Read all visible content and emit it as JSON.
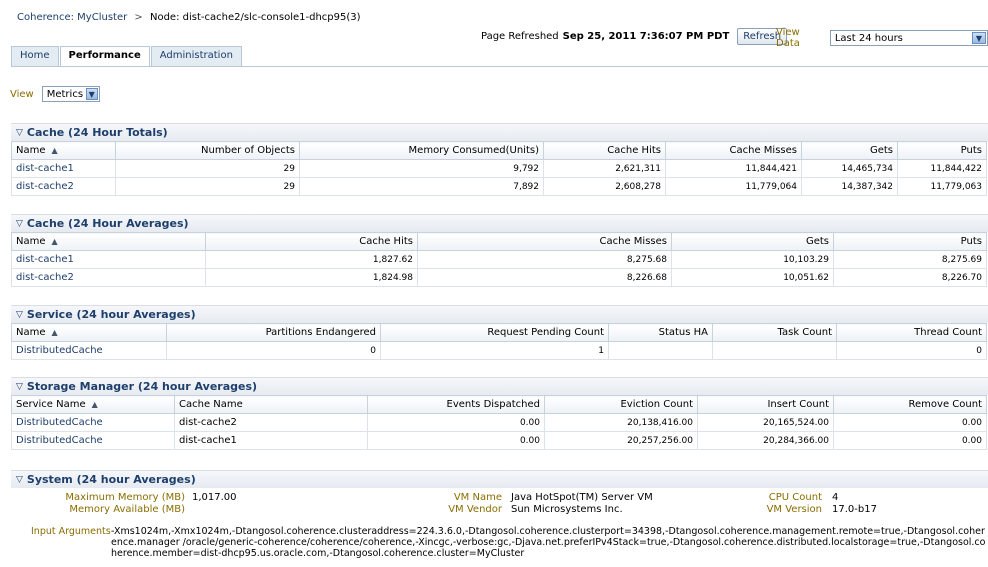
{
  "breadcrumb": {
    "cluster": "Coherence: MyCluster",
    "separator": ">",
    "node": "Node: dist-cache2/slc-console1-dhcp95(3)"
  },
  "header": {
    "refreshed_label": "Page Refreshed",
    "refreshed_value": "Sep 25, 2011 7:36:07 PM PDT",
    "refresh_button": "Refresh",
    "view_data_label": "View Data",
    "view_data_value": "Last 24 hours"
  },
  "tabs": [
    {
      "label": "Home"
    },
    {
      "label": "Performance"
    },
    {
      "label": "Administration"
    }
  ],
  "view": {
    "label": "View",
    "value": "Metrics"
  },
  "cache_totals": {
    "title": "Cache (24 Hour Totals)",
    "columns": [
      "Name",
      "Number of Objects",
      "Memory Consumed(Units)",
      "Cache Hits",
      "Cache Misses",
      "Gets",
      "Puts"
    ],
    "rows": [
      [
        "dist-cache1",
        "29",
        "9,792",
        "2,621,311",
        "11,844,421",
        "14,465,734",
        "11,844,422"
      ],
      [
        "dist-cache2",
        "29",
        "7,892",
        "2,608,278",
        "11,779,064",
        "14,387,342",
        "11,779,063"
      ]
    ]
  },
  "cache_averages": {
    "title": "Cache (24 Hour Averages)",
    "columns": [
      "Name",
      "Cache Hits",
      "Cache Misses",
      "Gets",
      "Puts"
    ],
    "rows": [
      [
        "dist-cache1",
        "1,827.62",
        "8,275.68",
        "10,103.29",
        "8,275.69"
      ],
      [
        "dist-cache2",
        "1,824.98",
        "8,226.68",
        "10,051.62",
        "8,226.70"
      ]
    ]
  },
  "service": {
    "title": "Service (24 hour Averages)",
    "columns": [
      "Name",
      "Partitions Endangered",
      "Request Pending Count",
      "Status HA",
      "Task Count",
      "Thread Count"
    ],
    "rows": [
      [
        "DistributedCache",
        "0",
        "1",
        "",
        "",
        "0"
      ]
    ]
  },
  "storage": {
    "title": "Storage Manager (24 hour Averages)",
    "columns": [
      "Service Name",
      "Cache Name",
      "Events Dispatched",
      "Eviction Count",
      "Insert Count",
      "Remove Count"
    ],
    "rows": [
      [
        "DistributedCache",
        "dist-cache2",
        "0.00",
        "20,138,416.00",
        "20,165,524.00",
        "0.00"
      ],
      [
        "DistributedCache",
        "dist-cache1",
        "0.00",
        "20,257,256.00",
        "20,284,366.00",
        "0.00"
      ]
    ]
  },
  "system": {
    "title": "System (24 hour Averages)",
    "max_memory_label": "Maximum Memory (MB)",
    "max_memory": "1,017.00",
    "mem_avail_label": "Memory Available (MB)",
    "mem_avail": "",
    "vm_name_label": "VM Name",
    "vm_name": "Java HotSpot(TM) Server VM",
    "vm_vendor_label": "VM Vendor",
    "vm_vendor": "Sun Microsystems Inc.",
    "cpu_label": "CPU Count",
    "cpu": "4",
    "vm_version_label": "VM Version",
    "vm_version": "17.0-b17",
    "input_args_label": "Input Arguments",
    "input_args": "-Xms1024m,-Xmx1024m,-Dtangosol.coherence.clusteraddress=224.3.6.0,-Dtangosol.coherence.clusterport=34398,-Dtangosol.coherence.management.remote=true,-Dtangosol.coherence.manager /oracle/generic-coherence/coherence/coherence,-Xincgc,-verbose:gc,-Djava.net.preferIPv4Stack=true,-Dtangosol.coherence.distributed.localstorage=true,-Dtangosol.coherence.member=dist-dhcp95.us.oracle.com,-Dtangosol.coherence.cluster=MyCluster"
  }
}
